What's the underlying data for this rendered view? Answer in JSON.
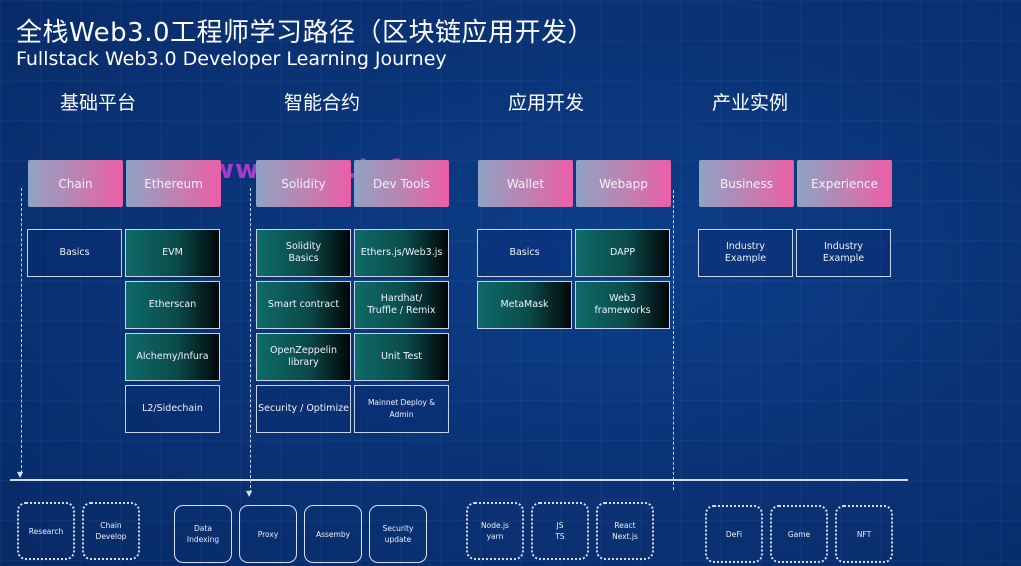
{
  "title": "全栈Web3.0工程师学习路径（区块链应用开发）",
  "subtitle": "Fullstack Web3.0 Developer Learning Journey",
  "watermark": "www.zywu.info",
  "sections": [
    {
      "name": "基础平台",
      "headers": [
        "Chain",
        "Ethereum"
      ],
      "col1": [
        "Basics"
      ],
      "col2": [
        "EVM",
        "Etherscan",
        "Alchemy/Infura",
        "L2/Sidechain"
      ],
      "bottom": [
        "Research",
        "Chain\nDevelop"
      ]
    },
    {
      "name": "智能合约",
      "headers": [
        "Solidity",
        "Dev Tools"
      ],
      "col1": [
        "Solidity\nBasics",
        "Smart contract",
        "OpenZeppelin\nlibrary",
        "Security / Optimize"
      ],
      "col2": [
        "Ethers.js/Web3.js",
        "Hardhat/\nTruffle / Remix",
        "Unit Test",
        "Mainnet Deploy & Admin"
      ],
      "bottom": [
        "Data\nIndexing",
        "Proxy",
        "Assemby",
        "Security\nupdate"
      ]
    },
    {
      "name": "应用开发",
      "headers": [
        "Wallet",
        "Webapp"
      ],
      "col1": [
        "Basics",
        "MetaMask"
      ],
      "col2": [
        "DAPP",
        "Web3\nframeworks"
      ],
      "bottom": [
        "Node.js\nyarn",
        "JS\nTS",
        "React\nNext.js"
      ]
    },
    {
      "name": "产业实例",
      "headers": [
        "Business",
        "Experience"
      ],
      "col1": [
        "Industry\nExample"
      ],
      "col2": [
        "Industry\nExample"
      ],
      "bottom": [
        "DeFi",
        "Game",
        "NFT"
      ]
    }
  ]
}
